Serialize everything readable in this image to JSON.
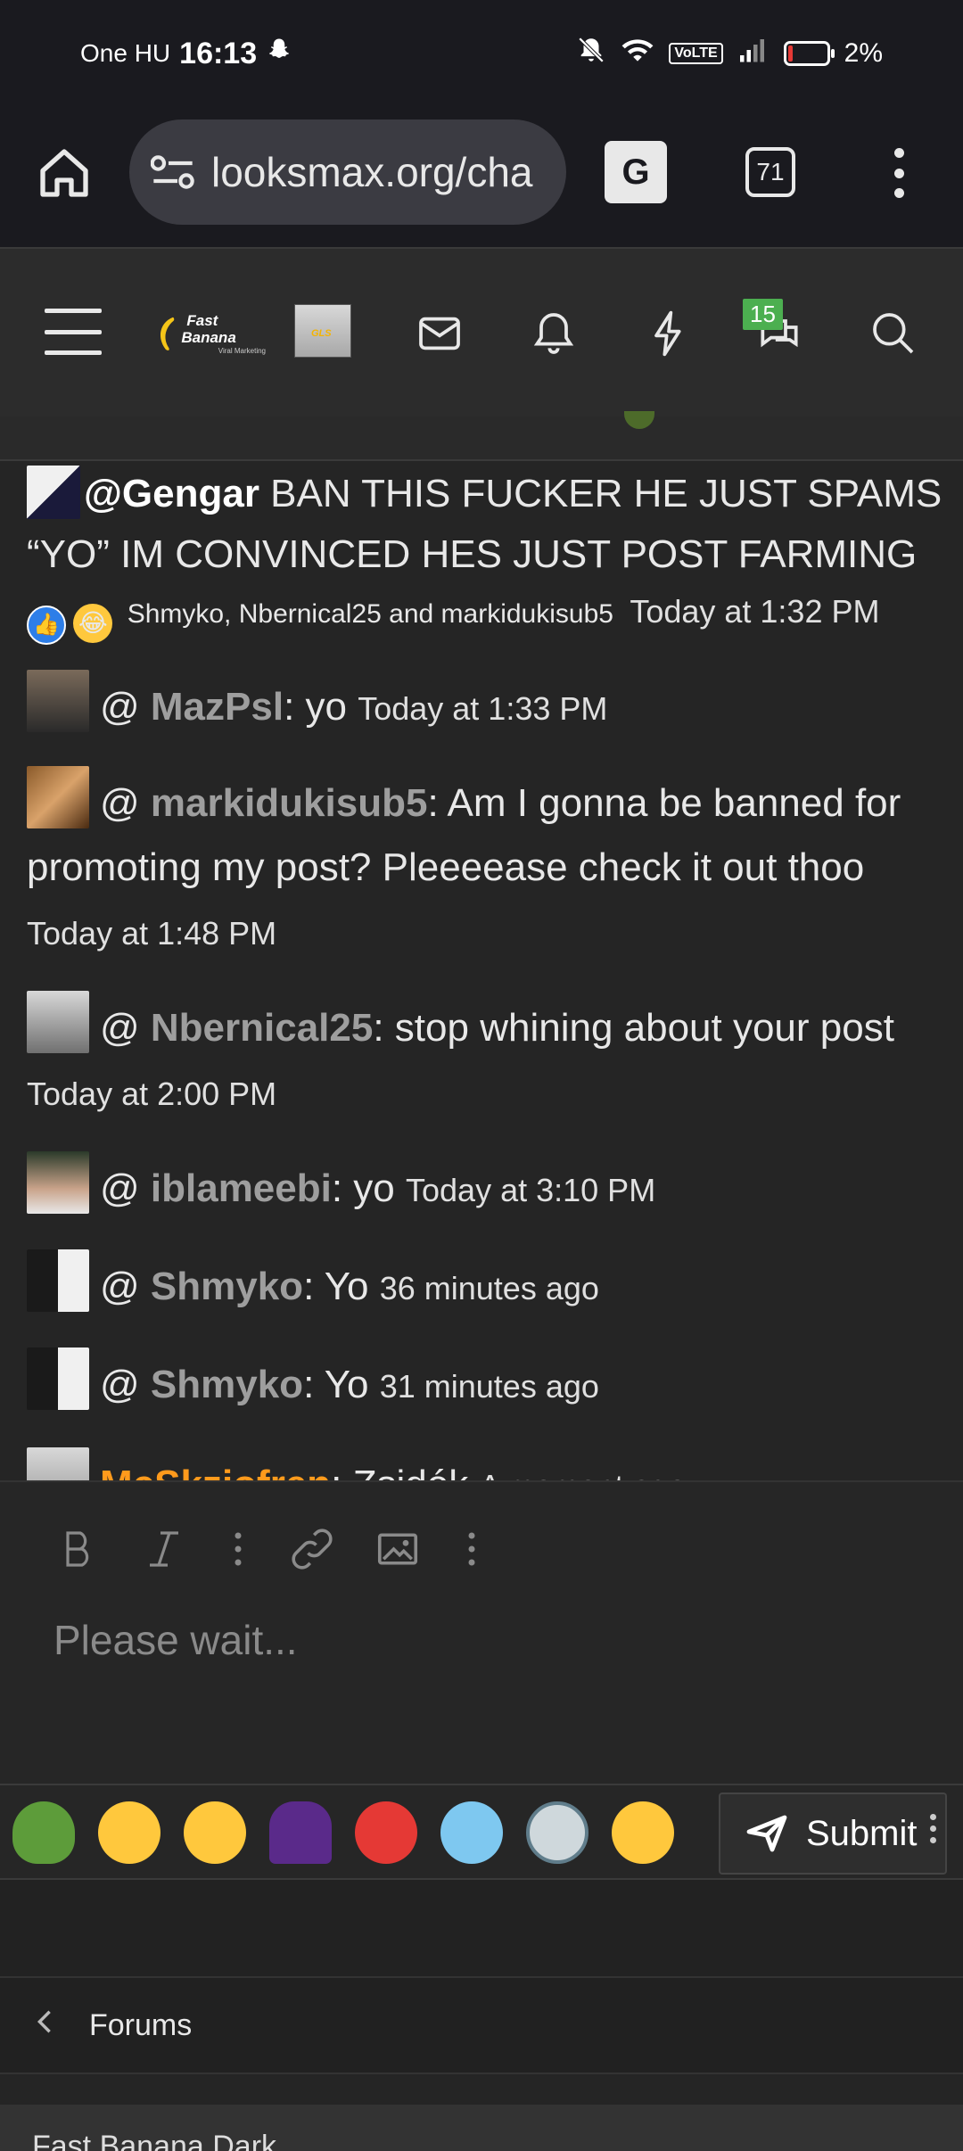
{
  "status_bar": {
    "carrier": "One HU",
    "time": "16:13",
    "volte": "VoLTE",
    "battery": "2%"
  },
  "browser": {
    "url": "looksmax.org/cha",
    "tabs_count": "71",
    "translate_label": "G"
  },
  "header": {
    "brand_name": "Fast Banana",
    "brand_sub": "Viral Marketing",
    "notifications_badge": "15"
  },
  "messages": [
    {
      "mention": "@Gengar",
      "text": " BAN THIS FUCKER HE JUST SPAMS “YO” IM CONVINCED HES JUST POST FARMING",
      "reactions": "Shmyko, Nbernical25 and markidukisub5",
      "time": "Today at 1:32 PM"
    },
    {
      "prefix": "@ ",
      "user": "MazPsl",
      "text": ": yo",
      "time": "Today at 1:33 PM"
    },
    {
      "prefix": "@ ",
      "user": "markidukisub5",
      "text": ": Am I gonna be banned for promoting my post? Pleeeease check it out thoo",
      "time": "Today at 1:48 PM"
    },
    {
      "prefix": "@ ",
      "user": "Nbernical25",
      "text": ": stop whining about your post",
      "time": "Today at 2:00 PM"
    },
    {
      "prefix": "@ ",
      "user": "iblameebi",
      "text": ": yo",
      "time": "Today at 3:10 PM"
    },
    {
      "prefix": "@ ",
      "user": "Shmyko",
      "text": ": Yo",
      "time": "36 minutes ago"
    },
    {
      "prefix": "@ ",
      "user": "Shmyko",
      "text": ": Yo",
      "time": "31 minutes ago"
    },
    {
      "user": "McSkziofren",
      "text": ": Zsidók",
      "time": "A moment ago"
    }
  ],
  "editor": {
    "placeholder": "Please wait..."
  },
  "submit_label": "Submit",
  "breadcrumb": {
    "label": "Forums"
  },
  "footer_text": "Fast Banana Dark",
  "colors": {
    "highlight_user": "#ff9a1c",
    "badge": "#4caf50"
  }
}
